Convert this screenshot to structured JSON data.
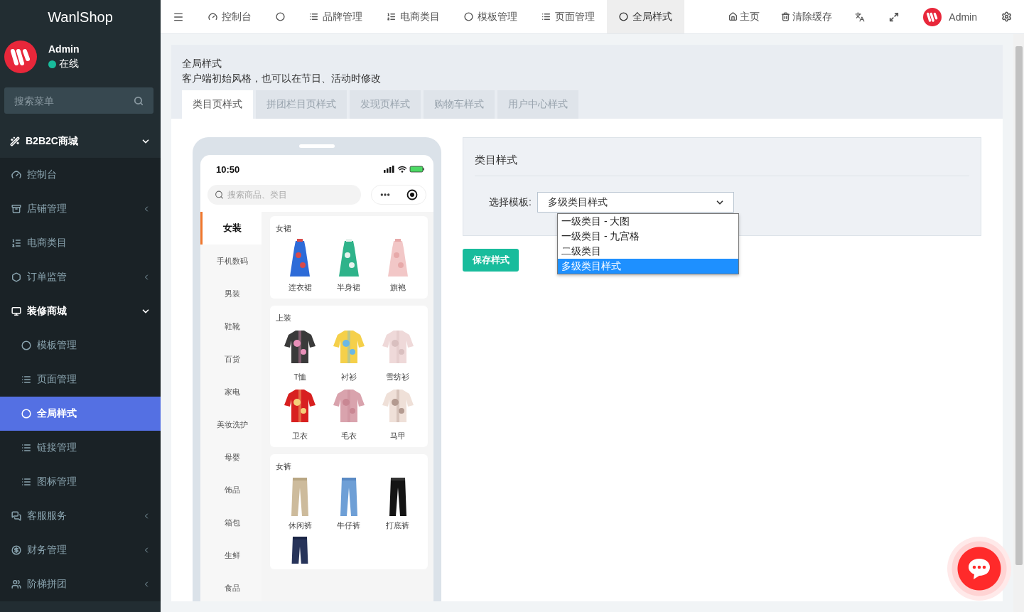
{
  "sidebar": {
    "logo": "WanlShop",
    "user": {
      "name": "Admin",
      "status": "在线"
    },
    "search": {
      "placeholder": "搜索菜单"
    },
    "menu": [
      {
        "label": "B2B2C商城",
        "expanded": true,
        "children": [
          {
            "label": "控制台",
            "selected": false
          },
          {
            "label": "店铺管理",
            "selected": false,
            "expanded": false
          },
          {
            "label": "电商类目",
            "selected": false
          },
          {
            "label": "订单监管",
            "selected": false,
            "expanded": false
          },
          {
            "label": "装修商城",
            "selected": false,
            "expanded": true,
            "children": [
              {
                "label": "模板管理",
                "selected": false
              },
              {
                "label": "页面管理",
                "selected": false
              },
              {
                "label": "全局样式",
                "selected": true
              },
              {
                "label": "链接管理",
                "selected": false
              },
              {
                "label": "图标管理",
                "selected": false
              }
            ]
          },
          {
            "label": "客服服务",
            "selected": false,
            "expanded": false
          },
          {
            "label": "财务管理",
            "selected": false,
            "expanded": false
          },
          {
            "label": "阶梯拼团",
            "selected": false,
            "expanded": false
          }
        ]
      }
    ]
  },
  "top_tabs": [
    {
      "label": "控制台",
      "selected": false
    },
    {
      "selected": false
    },
    {
      "label": "品牌管理",
      "selected": false
    },
    {
      "label": "电商类目",
      "selected": false
    },
    {
      "label": "模板管理",
      "selected": false
    },
    {
      "label": "页面管理",
      "selected": false
    },
    {
      "label": "全局样式",
      "selected": true
    }
  ],
  "top_actions": [
    {
      "label": "主页"
    },
    {
      "label": "清除缓存"
    }
  ],
  "top_user": {
    "name": "Admin"
  },
  "page_header": {
    "title": "全局样式",
    "subtitle": "客户端初始风格，也可以在节日、活动时修改"
  },
  "style_tabs": [
    {
      "label": "类目页样式",
      "selected": true
    },
    {
      "label": "拼团栏目页样式",
      "selected": false
    },
    {
      "label": "发现页样式",
      "selected": false
    },
    {
      "label": "购物车样式",
      "selected": false
    },
    {
      "label": "用户中心样式",
      "selected": false
    }
  ],
  "phone": {
    "time": "10:50",
    "search": {
      "placeholder": "搜索商品、类目"
    },
    "categories": [
      {
        "label": "女装",
        "selected": true
      },
      {
        "label": "手机数码",
        "selected": false
      },
      {
        "label": "男装",
        "selected": false
      },
      {
        "label": "鞋靴",
        "selected": false
      },
      {
        "label": "百货",
        "selected": false
      },
      {
        "label": "家电",
        "selected": false
      },
      {
        "label": "美妆洗护",
        "selected": false
      },
      {
        "label": "母婴",
        "selected": false
      },
      {
        "label": "饰品",
        "selected": false
      },
      {
        "label": "箱包",
        "selected": false
      },
      {
        "label": "生鲜",
        "selected": false
      },
      {
        "label": "食品",
        "selected": false
      }
    ],
    "groups": [
      {
        "title": "女裙",
        "items": [
          {
            "label": "连衣裙"
          },
          {
            "label": "半身裙"
          },
          {
            "label": "旗袍"
          }
        ]
      },
      {
        "title": "上装",
        "items": [
          {
            "label": "T恤"
          },
          {
            "label": "衬衫"
          },
          {
            "label": "雪纺衫"
          },
          {
            "label": "卫衣"
          },
          {
            "label": "毛衣"
          },
          {
            "label": "马甲"
          }
        ]
      },
      {
        "title": "女裤",
        "items": [
          {
            "label": "休闲裤"
          },
          {
            "label": "牛仔裤"
          },
          {
            "label": "打底裤"
          },
          {
            "partial": true
          }
        ]
      }
    ]
  },
  "card": {
    "title": "类目样式",
    "field_label": "选择模板:",
    "select": {
      "value": "多级类目样式",
      "open": true,
      "options": [
        {
          "label": "一级类目 - 大图",
          "selected": false
        },
        {
          "label": "一级类目 - 九宫格",
          "selected": false
        },
        {
          "label": "二级类目",
          "selected": false
        },
        {
          "label": "多级类目样式",
          "selected": true
        }
      ]
    }
  },
  "save_button": {
    "label": "保存样式"
  }
}
